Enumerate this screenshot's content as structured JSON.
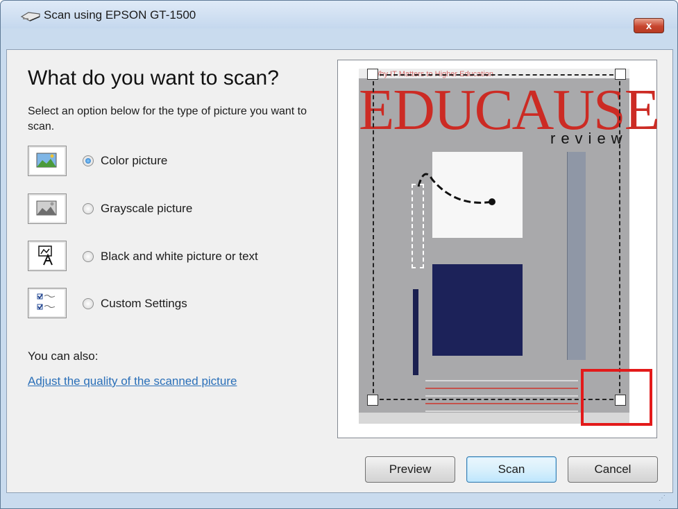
{
  "window": {
    "title": "Scan using EPSON GT-1500",
    "close_label": "x"
  },
  "main": {
    "heading": "What do you want to scan?",
    "description": "Select an option below for the type of picture you want to scan.",
    "options": [
      {
        "label": "Color picture",
        "selected": true,
        "icon": "color-picture-icon"
      },
      {
        "label": "Grayscale picture",
        "selected": false,
        "icon": "grayscale-picture-icon"
      },
      {
        "label": "Black and white picture or text",
        "selected": false,
        "icon": "black-white-text-icon"
      },
      {
        "label": "Custom Settings",
        "selected": false,
        "icon": "custom-settings-icon"
      }
    ],
    "also_text": "You can also:",
    "quality_link": "Adjust the quality of the scanned picture"
  },
  "preview": {
    "magazine": {
      "tagline": "Why IT Matters to Higher Education",
      "title": "EDUCAUSE",
      "subtitle": "review"
    }
  },
  "buttons": {
    "preview": "Preview",
    "scan": "Scan",
    "cancel": "Cancel"
  },
  "colors": {
    "accent": "#1c6bbd",
    "link": "#2a6fb8",
    "annotation": "#e31a1a",
    "magazine_title": "#cc2b24"
  }
}
